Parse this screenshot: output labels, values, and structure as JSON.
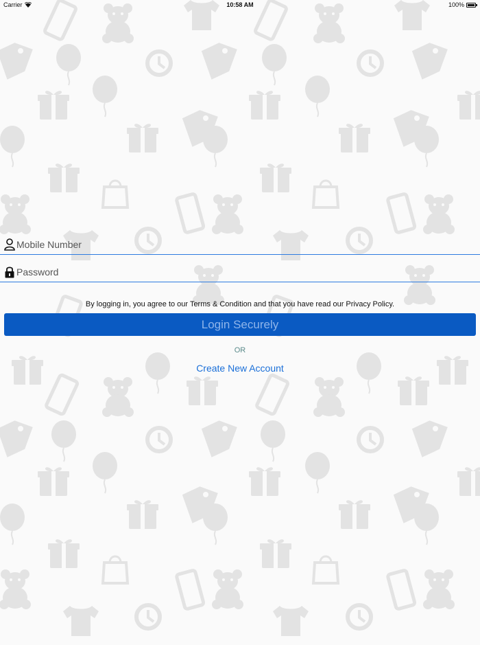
{
  "status_bar": {
    "carrier": "Carrier",
    "time": "10:58 AM",
    "battery": "100%"
  },
  "form": {
    "mobile_placeholder": "Mobile Number",
    "password_placeholder": "Password",
    "terms_text": "By logging in, you agree to our Terms & Condition and that you have read our Privacy Policy.",
    "login_label": "Login Securely",
    "or_label": "OR",
    "create_account_label": "Create New Account"
  },
  "colors": {
    "accent": "#0a5ac2",
    "link": "#1a6fd8",
    "field_line": "#2d7be0",
    "background": "#fafafa",
    "pattern": "#e3e3e3"
  },
  "icons": {
    "mobile_field": "user-icon",
    "password_field": "lock-icon",
    "background_pattern": [
      "gift-icon",
      "balloon-icon",
      "clock-icon",
      "teddy-bear-icon",
      "phone-icon",
      "tshirt-icon",
      "shopping-bag-icon",
      "price-tag-icon",
      "cart-icon"
    ]
  }
}
